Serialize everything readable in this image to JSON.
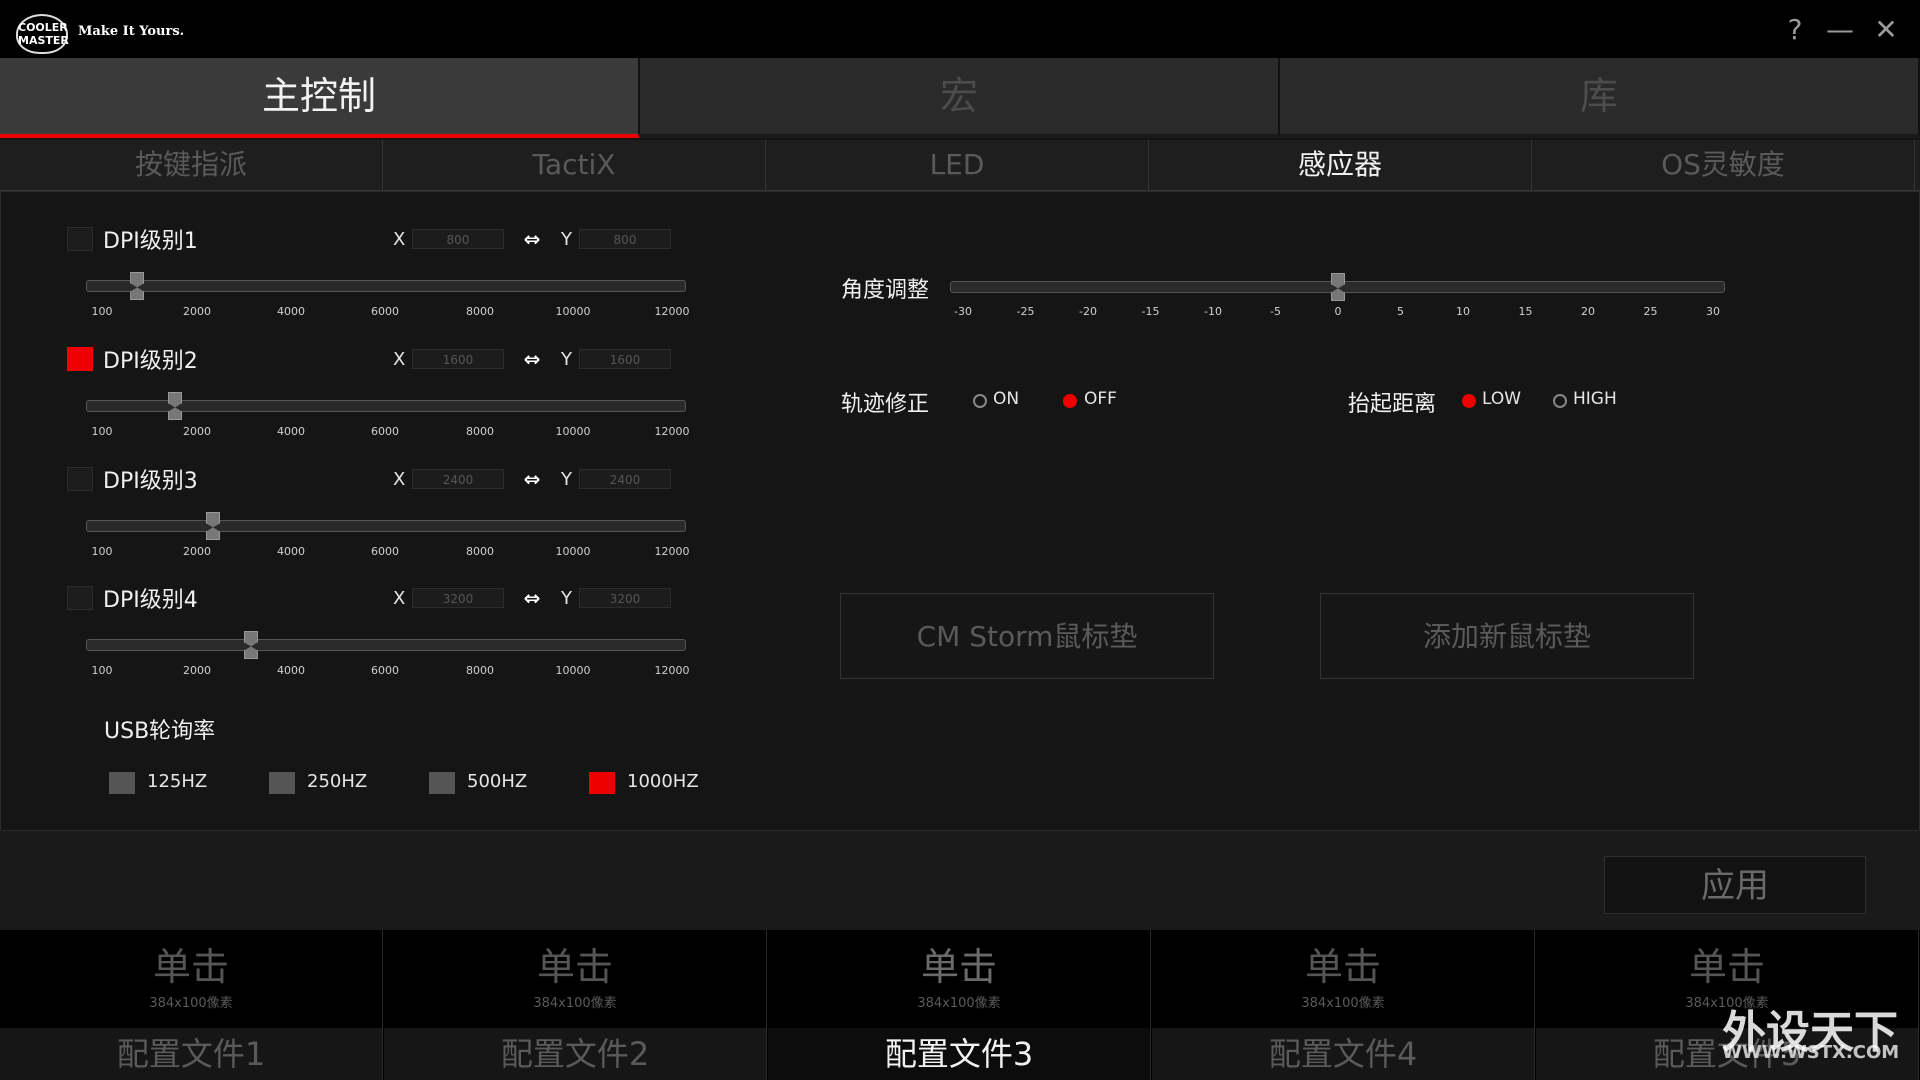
{
  "titlebar": {
    "logo_top": "COOLER",
    "logo_bottom": "MASTER",
    "tagline": "Make It Yours.",
    "help": "?",
    "minimize": "—",
    "close": "✕"
  },
  "main_tabs": [
    "主控制",
    "宏",
    "库"
  ],
  "sub_tabs": [
    "按键指派",
    "TactiX",
    "LED",
    "感应器",
    "OS灵敏度"
  ],
  "dpi_levels": [
    {
      "label": "DPI级别1",
      "x": "800",
      "y": "800",
      "checked": false
    },
    {
      "label": "DPI级别2",
      "x": "1600",
      "y": "1600",
      "checked": true
    },
    {
      "label": "DPI级别3",
      "x": "2400",
      "y": "2400",
      "checked": false
    },
    {
      "label": "DPI级别4",
      "x": "3200",
      "y": "3200",
      "checked": false
    }
  ],
  "dpi_labels": {
    "x": "X",
    "y": "Y",
    "link": "⇔"
  },
  "dpi_ticks": [
    "100",
    "2000",
    "4000",
    "6000",
    "8000",
    "10000",
    "12000"
  ],
  "usb": {
    "label": "USB轮询率",
    "options": [
      "125HZ",
      "250HZ",
      "500HZ",
      "1000HZ"
    ],
    "selected": "1000HZ"
  },
  "angle": {
    "label": "角度调整",
    "ticks": [
      "-30",
      "-25",
      "-20",
      "-15",
      "-10",
      "-5",
      "0",
      "5",
      "10",
      "15",
      "20",
      "25",
      "30"
    ],
    "value": 0
  },
  "trajectory": {
    "label": "轨迹修正",
    "on": "ON",
    "off": "OFF",
    "selected": "OFF"
  },
  "liftoff": {
    "label": "抬起距离",
    "low": "LOW",
    "high": "HIGH",
    "selected": "LOW"
  },
  "pads": {
    "cm_storm": "CM Storm鼠标垫",
    "add_new": "添加新鼠标垫"
  },
  "apply": "应用",
  "profiles": [
    {
      "click": "单击",
      "size": "384x100像素",
      "name": "配置文件1"
    },
    {
      "click": "单击",
      "size": "384x100像素",
      "name": "配置文件2"
    },
    {
      "click": "单击",
      "size": "384x100像素",
      "name": "配置文件3"
    },
    {
      "click": "单击",
      "size": "384x100像素",
      "name": "配置文件4"
    },
    {
      "click": "单击",
      "size": "384x100像素",
      "name": "配置文件5"
    }
  ],
  "active_profile": 2,
  "watermark": {
    "text": "外设天下",
    "url": "WWW.WSTX.COM"
  },
  "colors": {
    "accent": "#e00000",
    "background": "#141414"
  }
}
